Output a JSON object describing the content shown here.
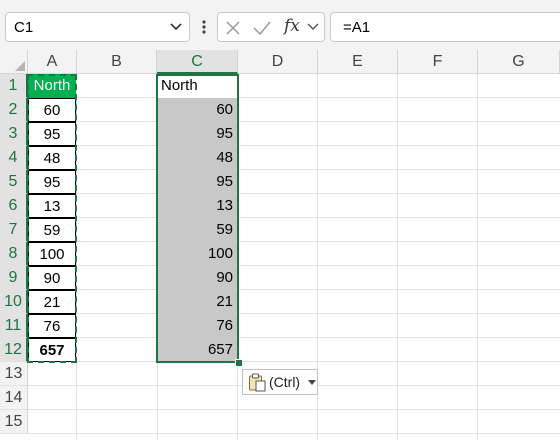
{
  "name_box": {
    "value": "C1"
  },
  "formula_bar": {
    "value": "=A1",
    "fx_label": "fx"
  },
  "columns": [
    "A",
    "B",
    "C",
    "D",
    "E",
    "F",
    "G"
  ],
  "rows": [
    "1",
    "2",
    "3",
    "4",
    "5",
    "6",
    "7",
    "8",
    "9",
    "10",
    "11",
    "12",
    "13",
    "14",
    "15"
  ],
  "source_column": {
    "header": "North",
    "values": [
      "60",
      "95",
      "48",
      "95",
      "13",
      "59",
      "100",
      "90",
      "21",
      "76"
    ],
    "total": "657"
  },
  "pasted_column": {
    "header": "North",
    "values": [
      "60",
      "95",
      "48",
      "95",
      "13",
      "59",
      "100",
      "90",
      "21",
      "76",
      "657"
    ]
  },
  "paste_options": {
    "label": "(Ctrl)"
  },
  "colors": {
    "header_fill": "#00b050",
    "selection_border": "#217346",
    "pasted_fill": "#c8c8c8"
  }
}
